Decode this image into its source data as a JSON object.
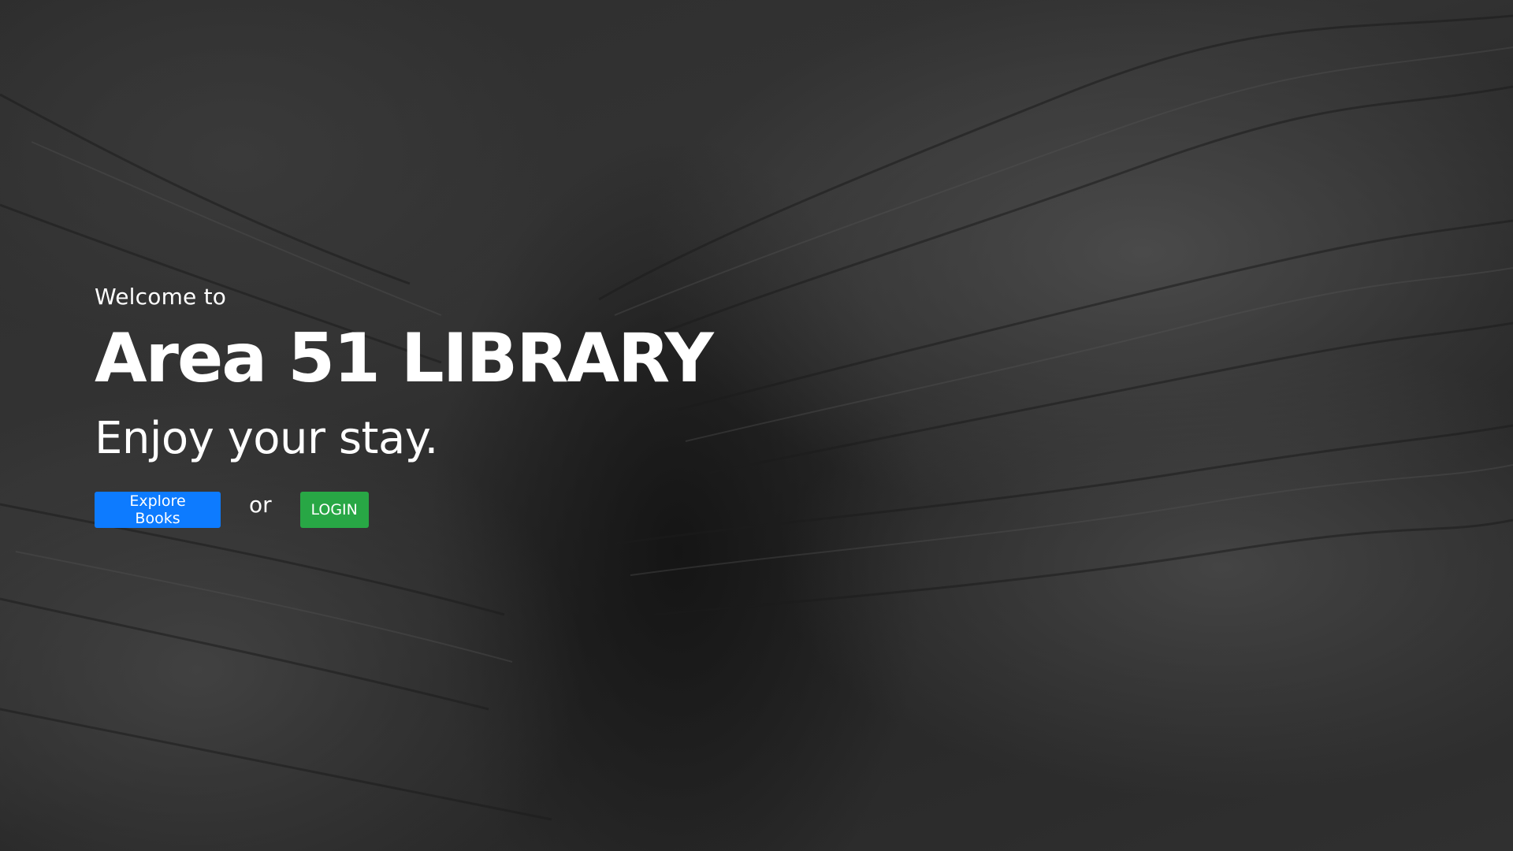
{
  "hero": {
    "welcome": "Welcome to",
    "title": "Area 51 LIBRARY",
    "tagline": "Enjoy your stay.",
    "separator": "or",
    "explore_label": "Explore Books",
    "login_label": "LOGIN"
  },
  "colors": {
    "primary_button": "#0d7bff",
    "success_button": "#28a745",
    "text": "#ffffff",
    "background": "#2a2a2a"
  }
}
